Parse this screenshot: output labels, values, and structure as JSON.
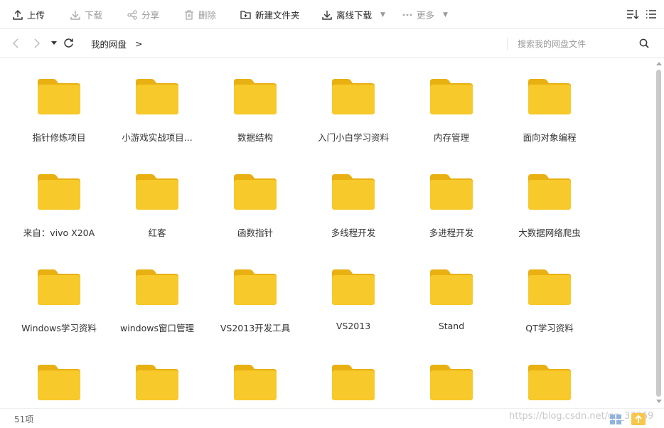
{
  "toolbar": {
    "upload": "上传",
    "download": "下载",
    "share": "分享",
    "delete": "删除",
    "new_folder": "新建文件夹",
    "offline_download": "离线下载",
    "more": "更多"
  },
  "address": {
    "breadcrumb_root": "我的网盘",
    "breadcrumb_sep": ">",
    "search_placeholder": "搜索我的网盘文件"
  },
  "folders": [
    "指针修炼项目",
    "小游戏实战项目...",
    "数据结构",
    "入门小白学习资料",
    "内存管理",
    "面向对象编程",
    "来自：vivo X20A",
    "红客",
    "函数指针",
    "多线程开发",
    "多进程开发",
    "大数据网络爬虫",
    "Windows学习资料",
    "windows窗口管理",
    "VS2013开发工具",
    "VS2013",
    "Stand",
    "QT学习资料",
    "",
    "",
    "",
    "",
    "",
    ""
  ],
  "status": {
    "count": "51项",
    "watermark": "https://blog.csdn.net/qq_37269"
  },
  "colors": {
    "folder_body": "#F7C92A",
    "folder_tab": "#E9B012",
    "scroll_thumb": "#C9C9C9"
  },
  "icons": [
    "upload-icon",
    "download-icon",
    "share-icon",
    "delete-icon",
    "new-folder-icon",
    "offline-download-icon",
    "more-icon",
    "sort-icon",
    "list-view-icon",
    "back-icon",
    "forward-icon",
    "history-dropdown-icon",
    "refresh-icon",
    "search-icon",
    "folder-icon",
    "grid-view-icon"
  ]
}
